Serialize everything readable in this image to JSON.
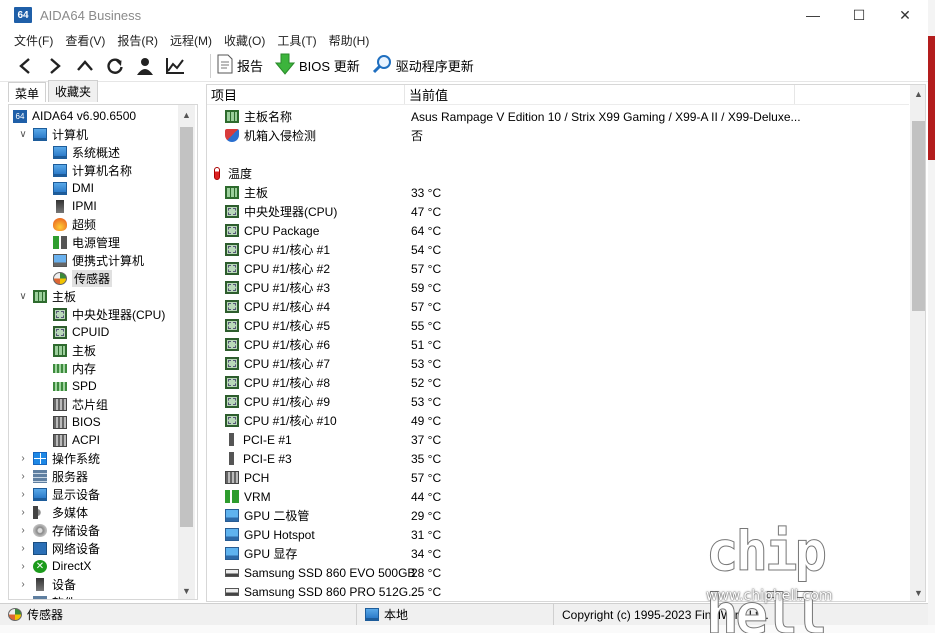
{
  "window": {
    "logo": "64",
    "title": "AIDA64 Business",
    "controls": {
      "minimize": "—",
      "maximize": "☐",
      "close": "✕"
    }
  },
  "menu": [
    "文件(F)",
    "查看(V)",
    "报告(R)",
    "远程(M)",
    "收藏(O)",
    "工具(T)",
    "帮助(H)"
  ],
  "toolbar": {
    "nav_icons": [
      "back-icon",
      "forward-icon",
      "up-icon",
      "refresh-icon",
      "user-icon",
      "chart-icon"
    ],
    "report_label": "报告",
    "bios_update_label": "BIOS 更新",
    "driver_update_label": "驱动程序更新"
  },
  "left_tabs": {
    "menu": "菜单",
    "favorites": "收藏夹"
  },
  "tree": {
    "root": "AIDA64 v6.90.6500",
    "computer": "计算机",
    "computer_children": [
      "系统概述",
      "计算机名称",
      "DMI",
      "IPMI",
      "超频",
      "电源管理",
      "便携式计算机",
      "传感器"
    ],
    "motherboard": "主板",
    "motherboard_children": [
      "中央处理器(CPU)",
      "CPUID",
      "主板",
      "内存",
      "SPD",
      "芯片组",
      "BIOS",
      "ACPI"
    ],
    "others": [
      "操作系统",
      "服务器",
      "显示设备",
      "多媒体",
      "存储设备",
      "网络设备",
      "DirectX",
      "设备",
      "软件"
    ]
  },
  "grid": {
    "col_item": "项目",
    "col_value": "当前值",
    "summary": [
      {
        "label": "主板名称",
        "value": "Asus Rampage V Edition 10 / Strix X99 Gaming / X99-A II / X99-Deluxe..."
      },
      {
        "label": "机箱入侵检测",
        "value": "否"
      }
    ],
    "temperature_title": "温度",
    "temperatures": [
      {
        "label": "主板",
        "value": "33 °C",
        "icon": "board"
      },
      {
        "label": "中央处理器(CPU)",
        "value": "47 °C",
        "icon": "chip"
      },
      {
        "label": "CPU Package",
        "value": "64 °C",
        "icon": "chip"
      },
      {
        "label": "CPU #1/核心 #1",
        "value": "54 °C",
        "icon": "chip"
      },
      {
        "label": "CPU #1/核心 #2",
        "value": "57 °C",
        "icon": "chip"
      },
      {
        "label": "CPU #1/核心 #3",
        "value": "59 °C",
        "icon": "chip"
      },
      {
        "label": "CPU #1/核心 #4",
        "value": "57 °C",
        "icon": "chip"
      },
      {
        "label": "CPU #1/核心 #5",
        "value": "55 °C",
        "icon": "chip"
      },
      {
        "label": "CPU #1/核心 #6",
        "value": "51 °C",
        "icon": "chip"
      },
      {
        "label": "CPU #1/核心 #7",
        "value": "53 °C",
        "icon": "chip"
      },
      {
        "label": "CPU #1/核心 #8",
        "value": "52 °C",
        "icon": "chip"
      },
      {
        "label": "CPU #1/核心 #9",
        "value": "53 °C",
        "icon": "chip"
      },
      {
        "label": "CPU #1/核心 #10",
        "value": "49 °C",
        "icon": "chip"
      },
      {
        "label": "PCI-E #1",
        "value": "37 °C",
        "icon": "pci"
      },
      {
        "label": "PCI-E #3",
        "value": "35 °C",
        "icon": "pci"
      },
      {
        "label": "PCH",
        "value": "57 °C",
        "icon": "pch"
      },
      {
        "label": "VRM",
        "value": "44 °C",
        "icon": "vrm"
      },
      {
        "label": "GPU 二极管",
        "value": "29 °C",
        "icon": "gpu"
      },
      {
        "label": "GPU Hotspot",
        "value": "31 °C",
        "icon": "gpu"
      },
      {
        "label": "GPU 显存",
        "value": "34 °C",
        "icon": "gpu"
      },
      {
        "label": "Samsung SSD 860 EVO 500GB",
        "value": "28 °C",
        "icon": "ssd"
      },
      {
        "label": "Samsung SSD 860 PRO 512G...",
        "value": "25 °C",
        "icon": "ssd"
      }
    ]
  },
  "status": {
    "sensor": "传感器",
    "local": "本地",
    "copyright": "Copyright (c) 1995-2023 FinalWire Ltd."
  },
  "watermark": {
    "url": "www.chiphell.com",
    "logo_text": "chip hell"
  }
}
